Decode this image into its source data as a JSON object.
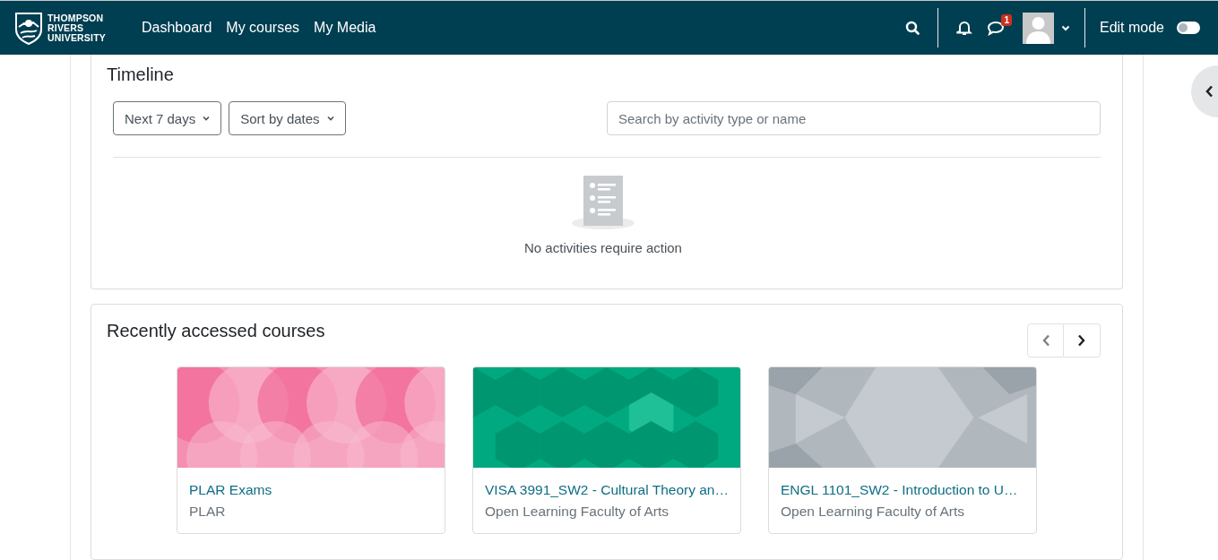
{
  "navbar": {
    "brand": [
      "THOMPSON",
      "RIVERS",
      "UNIVERSITY"
    ],
    "links": [
      "Dashboard",
      "My courses",
      "My Media"
    ],
    "message_count": "1",
    "edit_mode": {
      "label": "Edit mode",
      "on": false
    }
  },
  "timeline": {
    "title": "Timeline",
    "filters": [
      "Next 7 days",
      "Sort by dates"
    ],
    "search": {
      "placeholder": "Search by activity type or name"
    },
    "empty_message": "No activities require action"
  },
  "recent_courses": {
    "title": "Recently accessed courses",
    "courses": [
      {
        "name": "PLAR Exams",
        "category": "PLAR"
      },
      {
        "name": "VISA 3991_SW2 - Cultural Theory an…",
        "category": "Open Learning Faculty of Arts"
      },
      {
        "name": "ENGL 1101_SW2 - Introduction to U…",
        "category": "Open Learning Faculty of Arts"
      }
    ]
  }
}
